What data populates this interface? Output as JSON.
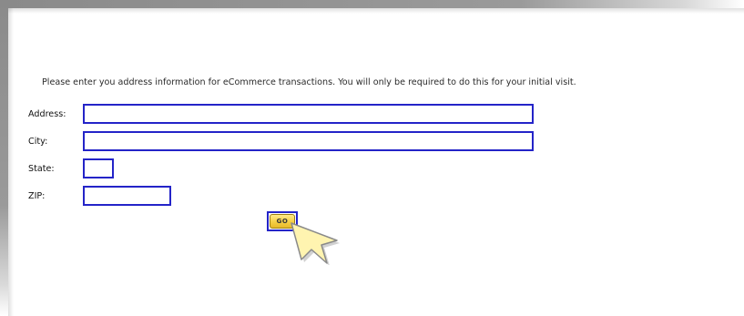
{
  "form": {
    "intro": "Please enter you address information for eCommerce transactions.  You will only be required to do this for your initial visit.",
    "address_label": "Address:",
    "address_value": "",
    "city_label": "City:",
    "city_value": "",
    "state_label": "State:",
    "state_value": "",
    "zip_label": "ZIP:",
    "zip_value": "",
    "go_label": "GO"
  },
  "colors": {
    "field_border": "#2424c8",
    "button_fill": "#f5cf45",
    "cursor_fill": "#fff4b0"
  },
  "icons": {
    "cursor": "arrow-pointer-icon"
  }
}
